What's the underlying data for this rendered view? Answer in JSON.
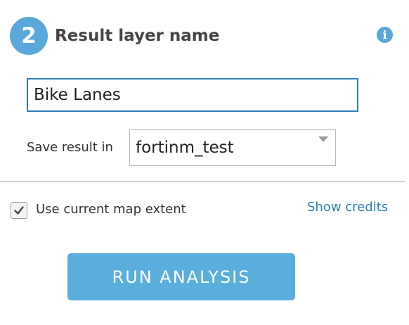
{
  "step": {
    "number": "2",
    "title": "Result layer name"
  },
  "info_icon": {
    "glyph": "i",
    "color": "#5aa8da"
  },
  "result_name": {
    "value": "Bike Lanes"
  },
  "save": {
    "label": "Save result in",
    "selected": "fortinm_test"
  },
  "extent": {
    "label": "Use current map extent",
    "checked": true
  },
  "credits": {
    "label": "Show credits"
  },
  "run_button": {
    "label": "RUN ANALYSIS",
    "color": "#5aaedd"
  },
  "colors": {
    "accent": "#5aa8da",
    "link": "#2b7fb5",
    "input_border": "#2c7fb8"
  }
}
